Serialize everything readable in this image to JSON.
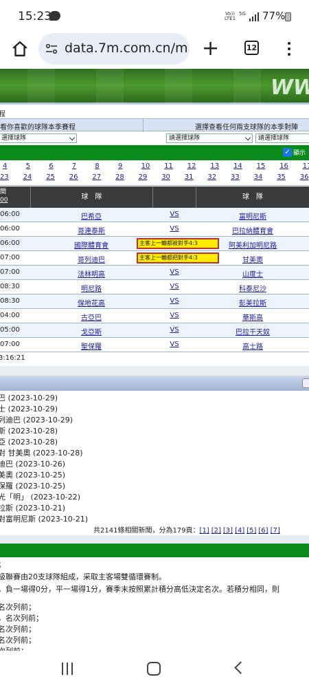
{
  "status": {
    "time": "15:23",
    "net": "Vo)) LTE1",
    "net5g": "5G",
    "battery": "77%"
  },
  "browser": {
    "url": "data.7m.com.cn/m",
    "tab_count": "12"
  },
  "page": {
    "pretitle": "程",
    "selector_left_title": "看你喜歡的球隊本季賽程",
    "selector_right_title": "選擇查看任何兩支球隊的本季對陣",
    "select_team_placeholder": "選擇球隊",
    "select_team_a": "請選擇球隊",
    "select_team_b": "請選擇球隊",
    "show_label": "顯示",
    "rounds": [
      [
        "4",
        "5",
        "6",
        "7",
        "8",
        "9",
        "10",
        "11",
        "12",
        "13",
        "14",
        "15",
        "16",
        "17"
      ],
      [
        "23",
        "24",
        "25",
        "26",
        "27",
        "28",
        "29",
        "30",
        "31",
        "32",
        "33",
        "34",
        "35",
        "36"
      ]
    ],
    "header": {
      "time_line1": "間",
      "time_line2": "00",
      "home": "球　隊",
      "away": "球　隊"
    },
    "matches": [
      {
        "time": "06:00",
        "home": "巴希亞",
        "vs": "VS",
        "away": "富明尼斯",
        "note": ""
      },
      {
        "time": "06:00",
        "home": "哥連泰斯",
        "vs": "VS",
        "away": "巴拉納體育會",
        "note": ""
      },
      {
        "time": "06:00",
        "home": "國際體育會",
        "vs": "",
        "away": "阿美利加明尼路",
        "note": "主客上一輪都被對手4:3"
      },
      {
        "time": "07:00",
        "home": "哥列迪巴",
        "vs": "",
        "away": "甘美奧",
        "note": "主客上一輪都把對手4:3"
      },
      {
        "time": "07:00",
        "home": "法林明高",
        "vs": "VS",
        "away": "山度士",
        "note": ""
      },
      {
        "time": "08:30",
        "home": "明尼路",
        "vs": "VS",
        "away": "科泰尼沙",
        "note": ""
      },
      {
        "time": "08:30",
        "home": "保地花高",
        "vs": "VS",
        "away": "彭美拉斯",
        "note": ""
      },
      {
        "time": "04:00",
        "home": "古亞巴",
        "vs": "VS",
        "away": "華斯高",
        "note": ""
      },
      {
        "time": "05:00",
        "home": "戈亞斯",
        "vs": "VS",
        "away": "巴拉干天奴",
        "note": ""
      },
      {
        "time": "07:00",
        "home": "聖保羅",
        "vs": "VS",
        "away": "高士路",
        "note": ""
      }
    ],
    "updated": "3:16:21",
    "news": [
      "巴 (2023-10-29)",
      "士 (2023-10-29)",
      "列迪巴 (2023-10-29)",
      "斯 (2023-10-28)",
      "亞 (2023-10-28)",
      "對 甘美奧 (2023-10-28)",
      "迪巴 (2023-10-26)",
      "美奧 (2023-10-25)",
      "保羅 (2023-10-25)",
      "光「明」 (2023-10-22)",
      "拉斯 (2023-10-21)",
      "對富明尼斯 (2023-10-21)"
    ],
    "pager_text": "共2141條相關新聞，分為179頁：",
    "pager_links": [
      "[1]",
      "[2]",
      "[3]",
      "[4]",
      "[5]",
      "[6]",
      "[7]"
    ],
    "rules": [
      "；",
      "級聯賽由20支球隊組成，采取主客場雙循環賽制。",
      "，負一場得0分，平一場得1分，賽季末按照累計積分高低決定名次。若積分相同，則",
      "名次列前；",
      "，名次列前；",
      "名次列前；",
      "名次列前；",
      "次列前；"
    ]
  }
}
